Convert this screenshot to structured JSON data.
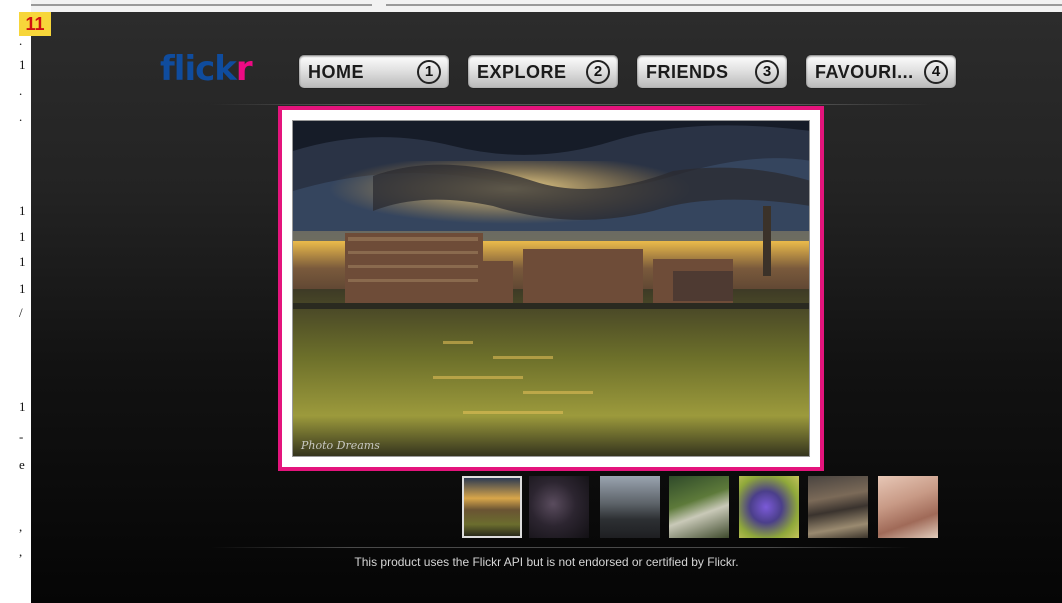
{
  "slide": {
    "number": "11"
  },
  "app": {
    "logo_prefix": "flick",
    "logo_suffix": "r",
    "colors": {
      "logo_blue": "#0f4c9e",
      "logo_pink": "#ee0a84",
      "frame": "#e4147c"
    }
  },
  "nav": [
    {
      "label": "HOME",
      "number": "1"
    },
    {
      "label": "EXPLORE",
      "number": "2"
    },
    {
      "label": "FRIENDS",
      "number": "3"
    },
    {
      "label": "FAVOURI...",
      "number": "4"
    }
  ],
  "main_photo": {
    "watermark": "Photo Dreams"
  },
  "thumbnails": [
    {
      "name": "thumb-harbor-sunset",
      "selected": true
    },
    {
      "name": "thumb-dark-portrait",
      "selected": false
    },
    {
      "name": "thumb-road-car",
      "selected": false
    },
    {
      "name": "thumb-boat-garden",
      "selected": false
    },
    {
      "name": "thumb-purple-flower",
      "selected": false
    },
    {
      "name": "thumb-rock-landscape",
      "selected": false
    },
    {
      "name": "thumb-woman-portrait",
      "selected": false
    }
  ],
  "footer": {
    "disclaimer": "This product uses the Flickr API but is not endorsed or certified by Flickr."
  }
}
